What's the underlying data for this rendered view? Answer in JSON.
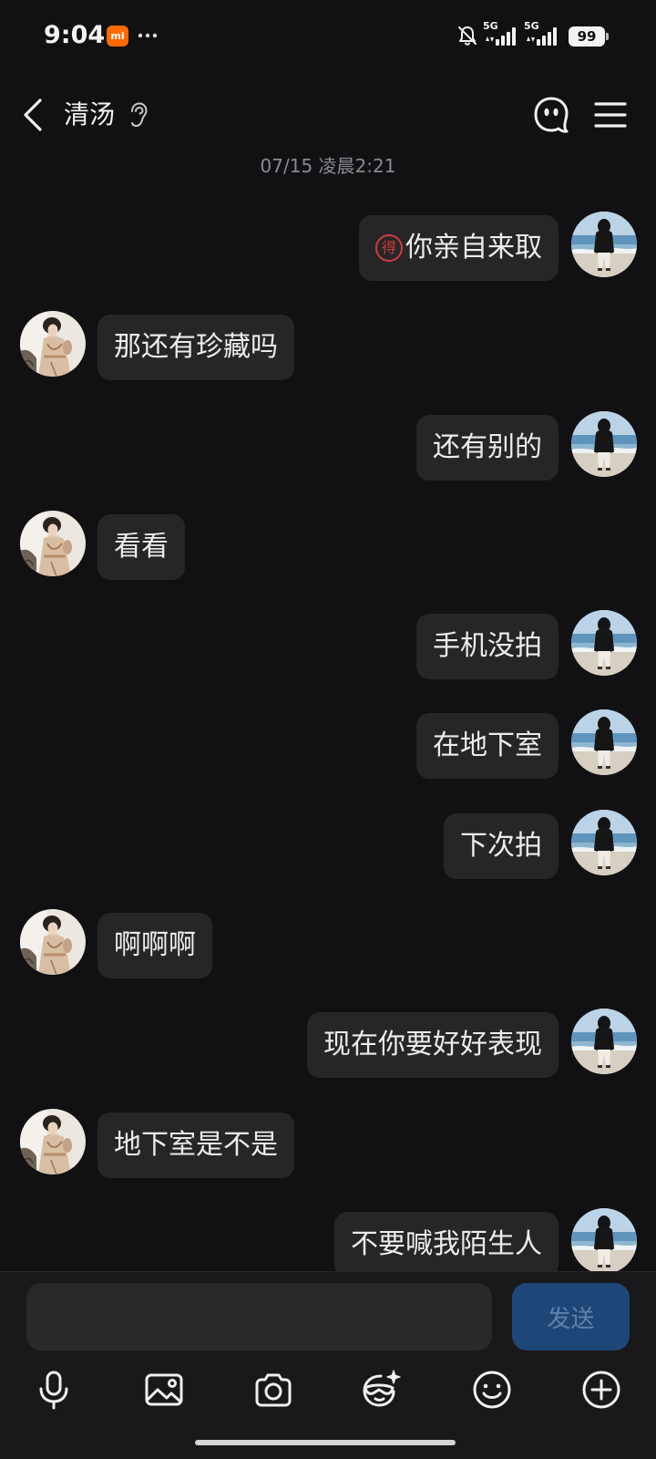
{
  "status_bar": {
    "time": "9:04",
    "logo_text": "mi",
    "network_1": "5G",
    "network_2": "5G",
    "battery": "99",
    "icons": [
      "xiaomi-logo-icon",
      "more-dots-icon",
      "bell-off-icon",
      "signal-5g-icon",
      "signal-5g-icon",
      "battery-icon"
    ]
  },
  "header": {
    "title": "清汤",
    "icons": [
      "back-chevron-icon",
      "ear-icon",
      "ghost-face-icon",
      "menu-icon"
    ]
  },
  "timestamp": "07/15 凌晨2:21",
  "messages": [
    {
      "outgoing": true,
      "stamp": "得",
      "text": "你亲自来取"
    },
    {
      "outgoing": false,
      "text": "那还有珍藏吗"
    },
    {
      "outgoing": true,
      "text": "还有别的"
    },
    {
      "outgoing": false,
      "text": "看看"
    },
    {
      "outgoing": true,
      "text": "手机没拍"
    },
    {
      "outgoing": true,
      "text": "在地下室"
    },
    {
      "outgoing": true,
      "text": "下次拍"
    },
    {
      "outgoing": false,
      "text": "啊啊啊"
    },
    {
      "outgoing": true,
      "text": "现在你要好好表现"
    },
    {
      "outgoing": false,
      "text": "地下室是不是"
    },
    {
      "outgoing": true,
      "text": "不要喊我陌生人"
    }
  ],
  "composer": {
    "input_value": "",
    "send_label": "发送"
  },
  "toolbar": {
    "icons": [
      "mic-icon",
      "image-icon",
      "camera-icon",
      "mask-sparkle-icon",
      "smile-icon",
      "plus-circle-icon"
    ]
  },
  "colors": {
    "background": "#111113",
    "bubble": "#262628",
    "text": "#ececec",
    "timestamp": "#8a8a8f",
    "panel": "#19191b",
    "input": "#29292c",
    "send_button": "#1e4677",
    "send_text": "#5e82ab",
    "stamp": "#d23b3b",
    "xiaomi_orange": "#ff6900"
  }
}
